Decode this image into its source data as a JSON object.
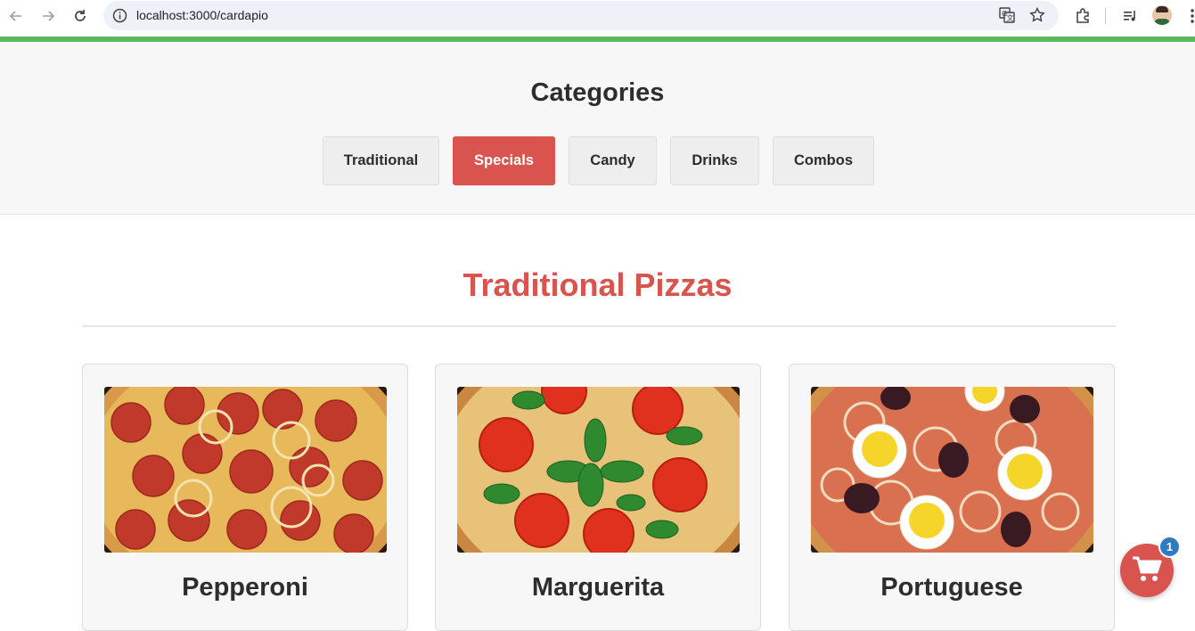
{
  "browser": {
    "url": "localhost:3000/cardapio",
    "icons": [
      "back-icon",
      "forward-icon",
      "reload-icon",
      "site-info-icon",
      "translate-icon",
      "bookmark-star-icon",
      "extensions-icon",
      "media-control-icon",
      "profile-avatar",
      "menu-kebab-icon"
    ]
  },
  "categories": {
    "title": "Categories",
    "items": [
      {
        "label": "Traditional",
        "active": false
      },
      {
        "label": "Specials",
        "active": true
      },
      {
        "label": "Candy",
        "active": false
      },
      {
        "label": "Drinks",
        "active": false
      },
      {
        "label": "Combos",
        "active": false
      }
    ]
  },
  "section": {
    "title": "Traditional Pizzas"
  },
  "products": [
    {
      "name": "Pepperoni",
      "image": "pepperoni-pizza-photo"
    },
    {
      "name": "Marguerita",
      "image": "marguerita-pizza-photo"
    },
    {
      "name": "Portuguese",
      "image": "portuguese-pizza-photo"
    }
  ],
  "cart": {
    "count": "1",
    "icon": "cart-icon"
  },
  "colors": {
    "accent": "#d9534f",
    "top_bar": "#5cb85c",
    "badge": "#2f7bbf"
  }
}
